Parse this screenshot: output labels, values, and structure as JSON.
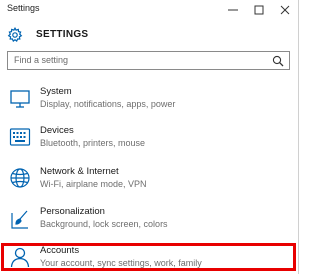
{
  "window": {
    "title": "Settings",
    "controls": {
      "minimize": "minimize",
      "maximize": "maximize",
      "close": "close"
    }
  },
  "header": {
    "title": "SETTINGS",
    "icon": "gear-icon"
  },
  "search": {
    "placeholder": "Find a setting",
    "icon": "search-icon"
  },
  "items": [
    {
      "label": "System",
      "description": "Display, notifications, apps, power",
      "icon": "display-icon"
    },
    {
      "label": "Devices",
      "description": "Bluetooth, printers, mouse",
      "icon": "keyboard-icon"
    },
    {
      "label": "Network & Internet",
      "description": "Wi-Fi, airplane mode, VPN",
      "icon": "globe-icon"
    },
    {
      "label": "Personalization",
      "description": "Background, lock screen, colors",
      "icon": "paintbrush-icon"
    },
    {
      "label": "Accounts",
      "description": "Your account, sync settings, work, family",
      "icon": "person-icon"
    }
  ],
  "colors": {
    "accent": "#0063b1",
    "highlight": "#e80000"
  }
}
